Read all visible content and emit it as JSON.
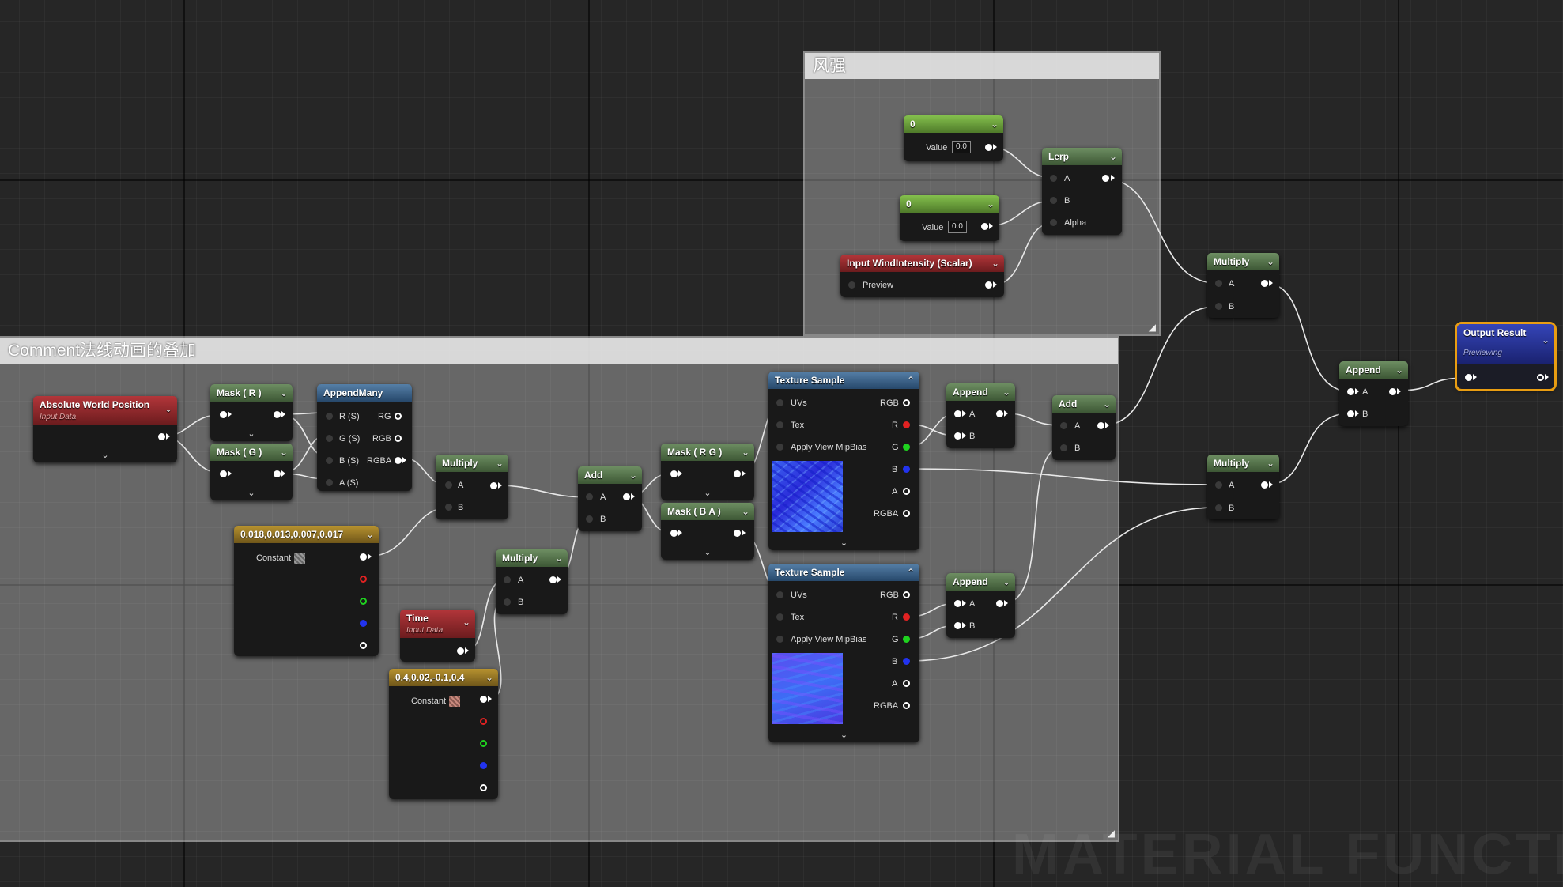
{
  "comments": {
    "wind": {
      "title": "风强"
    },
    "normal": {
      "title": "Comment法线动画的叠加"
    }
  },
  "watermark": "MATERIAL FUNCTION",
  "nodes": {
    "const0a": {
      "title": "0",
      "value_label": "Value",
      "value": "0.0"
    },
    "const0b": {
      "title": "0",
      "value_label": "Value",
      "value": "0.0"
    },
    "lerp": {
      "title": "Lerp",
      "pins": [
        "A",
        "B",
        "Alpha"
      ]
    },
    "input_wind": {
      "title": "Input WindIntensity (Scalar)",
      "pin": "Preview"
    },
    "mult_top": {
      "title": "Multiply",
      "pins": [
        "A",
        "B"
      ]
    },
    "output": {
      "title": "Output Result",
      "subtitle": "Previewing"
    },
    "append_final": {
      "title": "Append",
      "pins": [
        "A",
        "B"
      ]
    },
    "mult_mid": {
      "title": "Multiply",
      "pins": [
        "A",
        "B"
      ]
    },
    "add_right": {
      "title": "Add",
      "pins": [
        "A",
        "B"
      ]
    },
    "append1": {
      "title": "Append",
      "pins": [
        "A",
        "B"
      ]
    },
    "append2": {
      "title": "Append",
      "pins": [
        "A",
        "B"
      ]
    },
    "abs_world": {
      "title": "Absolute World Position",
      "subtitle": "Input Data"
    },
    "mask_r": {
      "title": "Mask ( R )"
    },
    "mask_g": {
      "title": "Mask ( G )"
    },
    "append_many": {
      "title": "AppendMany",
      "inputs": [
        "R (S)",
        "G (S)",
        "B (S)",
        "A (S)"
      ],
      "outputs": [
        "RG",
        "RGB",
        "RGBA"
      ]
    },
    "mult1": {
      "title": "Multiply",
      "pins": [
        "A",
        "B"
      ]
    },
    "const4a": {
      "title": "0.018,0.013,0.007,0.017",
      "label": "Constant"
    },
    "add_mid": {
      "title": "Add",
      "pins": [
        "A",
        "B"
      ]
    },
    "mask_rg": {
      "title": "Mask ( R G )"
    },
    "mask_ba": {
      "title": "Mask ( B A )"
    },
    "mult2": {
      "title": "Multiply",
      "pins": [
        "A",
        "B"
      ]
    },
    "time": {
      "title": "Time",
      "subtitle": "Input Data"
    },
    "const4b": {
      "title": "0.4,0.02,-0.1,0.4",
      "label": "Constant"
    },
    "tex1": {
      "title": "Texture Sample",
      "inputs": [
        "UVs",
        "Tex",
        "Apply View MipBias"
      ],
      "outputs": [
        "RGB",
        "R",
        "G",
        "B",
        "A",
        "RGBA"
      ]
    },
    "tex2": {
      "title": "Texture Sample",
      "inputs": [
        "UVs",
        "Tex",
        "Apply View MipBias"
      ],
      "outputs": [
        "RGB",
        "R",
        "G",
        "B",
        "A",
        "RGBA"
      ]
    }
  }
}
